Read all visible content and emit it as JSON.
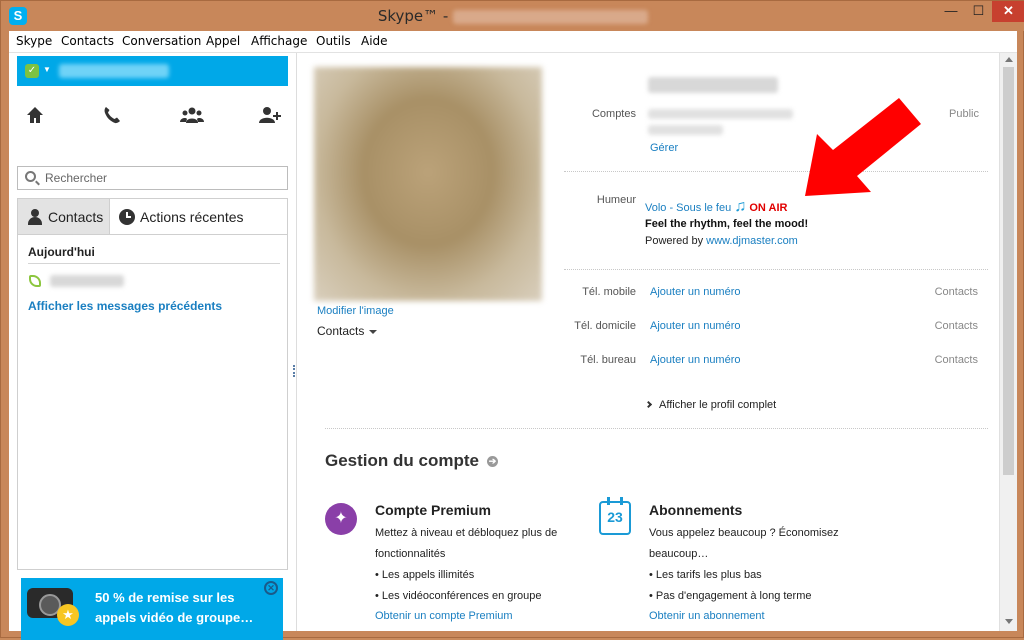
{
  "window": {
    "app_icon": "S",
    "title": "Skype™ -",
    "min": "—",
    "max": "☐",
    "close": "✕"
  },
  "menu": [
    "Skype",
    "Contacts",
    "Conversation",
    "Appel",
    "Affichage",
    "Outils",
    "Aide"
  ],
  "sidebar": {
    "search_placeholder": "Rechercher",
    "tab_contacts": "Contacts",
    "tab_recent": "Actions récentes",
    "today_label": "Aujourd'hui",
    "previous_messages": "Afficher les messages précédents",
    "promo_text": "50 % de remise sur les appels vidéo de groupe…",
    "promo_close": "✕"
  },
  "profile": {
    "edit_image": "Modifier l'image",
    "contacts_dropdown": "Contacts",
    "accounts_label": "Comptes",
    "accounts_visibility": "Public",
    "manage_link": "Gérer",
    "mood_label": "Humeur",
    "mood_song": "Volo - Sous le feu",
    "mood_note_icon": "♫",
    "mood_on_air": "ON AIR",
    "mood_tagline": "Feel the rhythm, feel the mood!",
    "mood_powered_prefix": "Powered by",
    "mood_powered_link": "www.djmaster.com",
    "phones": [
      {
        "label": "Tél. mobile",
        "action": "Ajouter un numéro",
        "visibility": "Contacts"
      },
      {
        "label": "Tél. domicile",
        "action": "Ajouter un numéro",
        "visibility": "Contacts"
      },
      {
        "label": "Tél. bureau",
        "action": "Ajouter un numéro",
        "visibility": "Contacts"
      }
    ],
    "full_profile": "Afficher le profil complet"
  },
  "account": {
    "section_title": "Gestion du compte",
    "premium": {
      "title": "Compte Premium",
      "text_lines": [
        "Mettez à niveau et débloquez plus de",
        "fonctionnalités",
        "• Les appels illimités",
        "• Les vidéoconférences en groupe"
      ],
      "link": "Obtenir un compte Premium"
    },
    "subscriptions": {
      "title": "Abonnements",
      "icon_text": "23",
      "text_lines": [
        "Vous appelez beaucoup ? Économisez",
        "beaucoup…",
        "• Les tarifs les plus bas",
        "• Pas d'engagement à long terme"
      ],
      "link": "Obtenir un abonnement"
    }
  },
  "colors": {
    "skype_blue": "#00a8e8",
    "link_blue": "#1a7fc1",
    "on_air_red": "#e10000",
    "annotation_arrow": "#ff0000",
    "premium_purple": "#8a3fa8"
  }
}
